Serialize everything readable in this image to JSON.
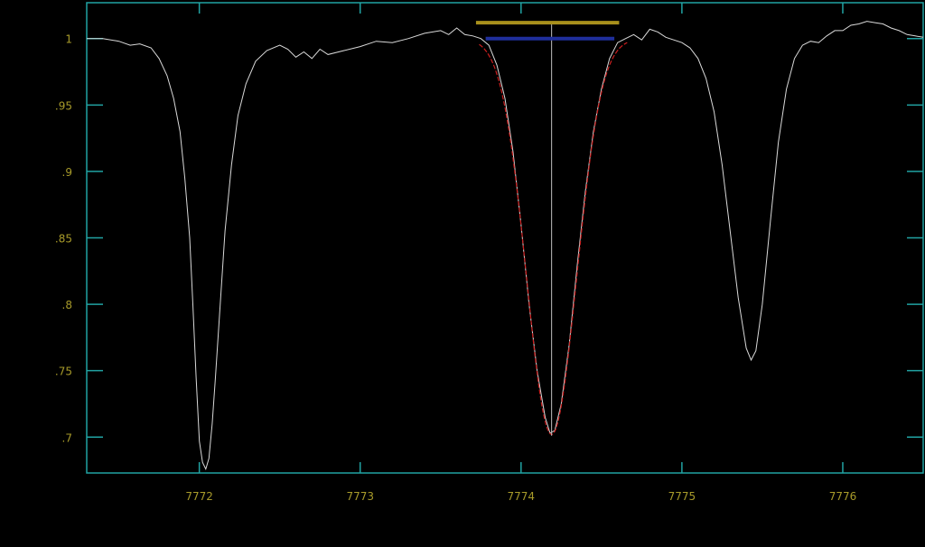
{
  "chart_data": {
    "type": "line",
    "xlim": [
      7771.3,
      7776.5
    ],
    "ylim": [
      0.673,
      1.027
    ],
    "x_ticks": [
      {
        "value": 7772,
        "label": "7772"
      },
      {
        "value": 7773,
        "label": "7773"
      },
      {
        "value": 7774,
        "label": "7774"
      },
      {
        "value": 7775,
        "label": "7775"
      },
      {
        "value": 7776,
        "label": "7776"
      }
    ],
    "y_ticks": [
      {
        "value": 1.0,
        "label": "1"
      },
      {
        "value": 0.95,
        "label": ".95"
      },
      {
        "value": 0.9,
        "label": ".9"
      },
      {
        "value": 0.85,
        "label": ".85"
      },
      {
        "value": 0.8,
        "label": ".8"
      },
      {
        "value": 0.75,
        "label": ".75"
      },
      {
        "value": 0.7,
        "label": ".7"
      }
    ],
    "grid": false,
    "colors": {
      "background": "#000000",
      "axes": "#21a3a3",
      "tick_labels": "#a89b2a",
      "spectrum": "#d9d9d9",
      "fit": "#cc1f1f",
      "center_marker": "#bfbfbf",
      "continuum_level": "#1f2f9c",
      "upper_bar": "#a8901c"
    },
    "series": [
      {
        "role": "spectrum",
        "points": [
          [
            7771.3,
            1.0
          ],
          [
            7771.4,
            1.0
          ],
          [
            7771.5,
            0.998
          ],
          [
            7771.57,
            0.995
          ],
          [
            7771.63,
            0.996
          ],
          [
            7771.7,
            0.993
          ],
          [
            7771.75,
            0.985
          ],
          [
            7771.8,
            0.972
          ],
          [
            7771.84,
            0.955
          ],
          [
            7771.88,
            0.93
          ],
          [
            7771.91,
            0.895
          ],
          [
            7771.94,
            0.85
          ],
          [
            7771.96,
            0.8
          ],
          [
            7771.98,
            0.745
          ],
          [
            7772.0,
            0.697
          ],
          [
            7772.02,
            0.681
          ],
          [
            7772.04,
            0.676
          ],
          [
            7772.06,
            0.684
          ],
          [
            7772.08,
            0.71
          ],
          [
            7772.1,
            0.745
          ],
          [
            7772.13,
            0.8
          ],
          [
            7772.16,
            0.855
          ],
          [
            7772.2,
            0.905
          ],
          [
            7772.24,
            0.942
          ],
          [
            7772.29,
            0.966
          ],
          [
            7772.35,
            0.983
          ],
          [
            7772.42,
            0.991
          ],
          [
            7772.5,
            0.995
          ],
          [
            7772.55,
            0.992
          ],
          [
            7772.6,
            0.986
          ],
          [
            7772.65,
            0.99
          ],
          [
            7772.7,
            0.985
          ],
          [
            7772.75,
            0.992
          ],
          [
            7772.8,
            0.988
          ],
          [
            7772.9,
            0.991
          ],
          [
            7773.0,
            0.994
          ],
          [
            7773.1,
            0.998
          ],
          [
            7773.2,
            0.997
          ],
          [
            7773.3,
            1.0
          ],
          [
            7773.4,
            1.004
          ],
          [
            7773.5,
            1.006
          ],
          [
            7773.55,
            1.003
          ],
          [
            7773.6,
            1.008
          ],
          [
            7773.65,
            1.003
          ],
          [
            7773.7,
            1.002
          ],
          [
            7773.75,
            1.0
          ],
          [
            7773.8,
            0.995
          ],
          [
            7773.85,
            0.98
          ],
          [
            7773.9,
            0.955
          ],
          [
            7773.95,
            0.915
          ],
          [
            7774.0,
            0.86
          ],
          [
            7774.05,
            0.8
          ],
          [
            7774.1,
            0.75
          ],
          [
            7774.15,
            0.715
          ],
          [
            7774.18,
            0.703
          ],
          [
            7774.21,
            0.705
          ],
          [
            7774.25,
            0.725
          ],
          [
            7774.3,
            0.77
          ],
          [
            7774.35,
            0.83
          ],
          [
            7774.4,
            0.885
          ],
          [
            7774.45,
            0.93
          ],
          [
            7774.5,
            0.962
          ],
          [
            7774.55,
            0.985
          ],
          [
            7774.6,
            0.997
          ],
          [
            7774.65,
            1.0
          ],
          [
            7774.7,
            1.003
          ],
          [
            7774.75,
            0.999
          ],
          [
            7774.8,
            1.007
          ],
          [
            7774.85,
            1.005
          ],
          [
            7774.9,
            1.001
          ],
          [
            7775.0,
            0.997
          ],
          [
            7775.05,
            0.993
          ],
          [
            7775.1,
            0.985
          ],
          [
            7775.15,
            0.97
          ],
          [
            7775.2,
            0.945
          ],
          [
            7775.25,
            0.905
          ],
          [
            7775.3,
            0.855
          ],
          [
            7775.35,
            0.805
          ],
          [
            7775.4,
            0.767
          ],
          [
            7775.43,
            0.758
          ],
          [
            7775.46,
            0.765
          ],
          [
            7775.5,
            0.8
          ],
          [
            7775.55,
            0.862
          ],
          [
            7775.6,
            0.922
          ],
          [
            7775.65,
            0.962
          ],
          [
            7775.7,
            0.985
          ],
          [
            7775.75,
            0.995
          ],
          [
            7775.8,
            0.998
          ],
          [
            7775.85,
            0.997
          ],
          [
            7775.9,
            1.002
          ],
          [
            7775.95,
            1.006
          ],
          [
            7776.0,
            1.006
          ],
          [
            7776.05,
            1.01
          ],
          [
            7776.1,
            1.011
          ],
          [
            7776.15,
            1.013
          ],
          [
            7776.2,
            1.012
          ],
          [
            7776.25,
            1.011
          ],
          [
            7776.3,
            1.008
          ],
          [
            7776.35,
            1.006
          ],
          [
            7776.4,
            1.003
          ],
          [
            7776.45,
            1.002
          ],
          [
            7776.5,
            1.001
          ]
        ]
      },
      {
        "role": "fit",
        "center": 7774.19,
        "depth": 0.298,
        "sigma": 0.155,
        "xrange": [
          7773.74,
          7774.66
        ]
      }
    ],
    "markers": {
      "center_line": {
        "x": 7774.19,
        "y_from": 0.701,
        "y_to": 1.012
      },
      "continuum_level": {
        "x_from": 7773.78,
        "x_to": 7774.58,
        "y": 1.0
      },
      "upper_bar": {
        "x_from": 7773.72,
        "x_to": 7774.61,
        "y": 1.012
      }
    }
  }
}
